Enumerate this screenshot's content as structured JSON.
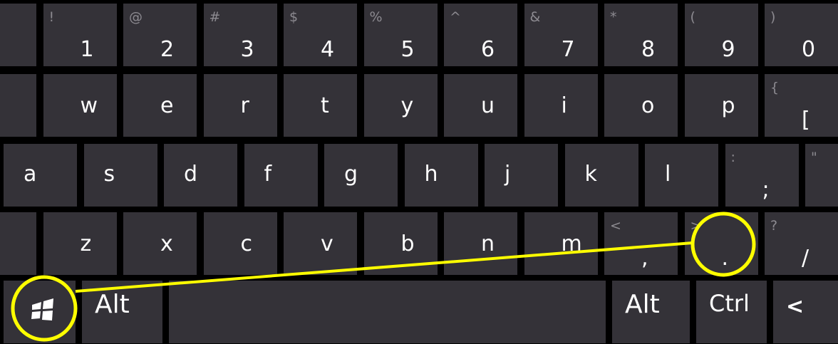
{
  "keyboard": {
    "rows": [
      [
        {
          "main": "",
          "sec": "",
          "name": "key-edge-left-1"
        },
        {
          "main": "1",
          "sec": "!",
          "name": "key-1"
        },
        {
          "main": "2",
          "sec": "@",
          "name": "key-2"
        },
        {
          "main": "3",
          "sec": "#",
          "name": "key-3"
        },
        {
          "main": "4",
          "sec": "$",
          "name": "key-4"
        },
        {
          "main": "5",
          "sec": "%",
          "name": "key-5"
        },
        {
          "main": "6",
          "sec": "^",
          "name": "key-6"
        },
        {
          "main": "7",
          "sec": "&",
          "name": "key-7"
        },
        {
          "main": "8",
          "sec": "*",
          "name": "key-8"
        },
        {
          "main": "9",
          "sec": "(",
          "name": "key-9"
        },
        {
          "main": "0",
          "sec": ")",
          "name": "key-0"
        },
        {
          "main": "",
          "sec": "_",
          "name": "key-minus"
        }
      ],
      [
        {
          "main": "",
          "sec": "",
          "name": "key-edge-left-2"
        },
        {
          "main": "w",
          "sec": "",
          "name": "key-w"
        },
        {
          "main": "e",
          "sec": "",
          "name": "key-e"
        },
        {
          "main": "r",
          "sec": "",
          "name": "key-r"
        },
        {
          "main": "t",
          "sec": "",
          "name": "key-t"
        },
        {
          "main": "y",
          "sec": "",
          "name": "key-y"
        },
        {
          "main": "u",
          "sec": "",
          "name": "key-u"
        },
        {
          "main": "i",
          "sec": "",
          "name": "key-i"
        },
        {
          "main": "o",
          "sec": "",
          "name": "key-o"
        },
        {
          "main": "p",
          "sec": "",
          "name": "key-p"
        },
        {
          "main": "[",
          "sec": "{",
          "name": "key-bracket-left"
        }
      ],
      [
        {
          "main": "a",
          "sec": "",
          "name": "key-a"
        },
        {
          "main": "s",
          "sec": "",
          "name": "key-s"
        },
        {
          "main": "d",
          "sec": "",
          "name": "key-d"
        },
        {
          "main": "f",
          "sec": "",
          "name": "key-f"
        },
        {
          "main": "g",
          "sec": "",
          "name": "key-g"
        },
        {
          "main": "h",
          "sec": "",
          "name": "key-h"
        },
        {
          "main": "j",
          "sec": "",
          "name": "key-j"
        },
        {
          "main": "k",
          "sec": "",
          "name": "key-k"
        },
        {
          "main": "l",
          "sec": "",
          "name": "key-l"
        },
        {
          "main": ";",
          "sec": ":",
          "name": "key-semicolon"
        },
        {
          "main": "",
          "sec": "\"",
          "name": "key-quote"
        }
      ],
      [
        {
          "main": "",
          "sec": "",
          "name": "key-edge-left-4"
        },
        {
          "main": "z",
          "sec": "",
          "name": "key-z"
        },
        {
          "main": "x",
          "sec": "",
          "name": "key-x"
        },
        {
          "main": "c",
          "sec": "",
          "name": "key-c"
        },
        {
          "main": "v",
          "sec": "",
          "name": "key-v"
        },
        {
          "main": "b",
          "sec": "",
          "name": "key-b"
        },
        {
          "main": "n",
          "sec": "",
          "name": "key-n"
        },
        {
          "main": "m",
          "sec": "",
          "name": "key-m"
        },
        {
          "main": ",",
          "sec": "<",
          "name": "key-comma"
        },
        {
          "main": ".",
          "sec": ">",
          "name": "key-period"
        },
        {
          "main": "/",
          "sec": "?",
          "name": "key-slash"
        }
      ],
      [
        {
          "main": "",
          "sec": "",
          "name": "key-windows",
          "icon": "windows-logo-icon"
        },
        {
          "main": "Alt",
          "sec": "",
          "name": "key-alt-left"
        },
        {
          "main": "",
          "sec": "",
          "name": "key-space"
        },
        {
          "main": "Alt",
          "sec": "",
          "name": "key-alt-right"
        },
        {
          "main": "Ctrl",
          "sec": "",
          "name": "key-ctrl-right"
        },
        {
          "main": "<",
          "sec": "",
          "name": "key-arrow-left"
        }
      ]
    ]
  },
  "annotation": {
    "highlight_color": "#ffff00",
    "highlighted_keys": [
      "key-windows",
      "key-period"
    ]
  }
}
